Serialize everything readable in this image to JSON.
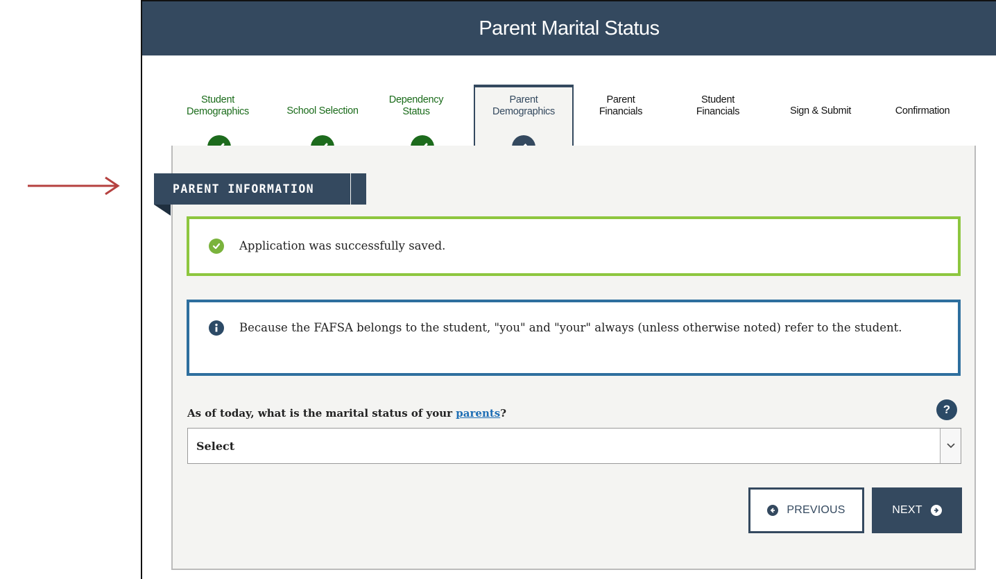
{
  "header": {
    "title": "Parent Marital Status"
  },
  "stepper": {
    "steps": [
      {
        "label": "Student Demographics",
        "state": "done"
      },
      {
        "label": "School Selection",
        "state": "done"
      },
      {
        "label": "Dependency Status",
        "state": "done"
      },
      {
        "label": "Parent Demographics",
        "state": "current"
      },
      {
        "label": "Parent Financials",
        "state": "todo"
      },
      {
        "label": "Student Financials",
        "state": "todo"
      },
      {
        "label": "Sign & Submit",
        "state": "todo"
      },
      {
        "label": "Confirmation",
        "state": "todo"
      }
    ]
  },
  "section": {
    "title": "PARENT INFORMATION"
  },
  "alerts": {
    "success": "Application was successfully saved.",
    "info": "Because the FAFSA belongs to the student, \"you\" and \"your\" always (unless otherwise noted) refer to the student."
  },
  "question": {
    "prefix": "As of today, what is the marital status of your ",
    "link": "parents",
    "suffix": "?",
    "help_label": "?"
  },
  "marital_select": {
    "value": "Select"
  },
  "buttons": {
    "previous": "PREVIOUS",
    "next": "NEXT"
  },
  "colors": {
    "header": "#34495f",
    "done": "#1d6b1d",
    "success_border": "#8dc63f",
    "info_border": "#2e6f9e",
    "pointer_arrow": "#b5413f"
  },
  "icons": {
    "pointer": "arrow-right-icon",
    "done": "checkmark-icon",
    "current": "pencil-icon",
    "success": "check-circle-icon",
    "info": "info-circle-icon",
    "help": "question-circle-icon",
    "select": "chevron-down-icon",
    "previous": "arrow-left-circle-icon",
    "next": "arrow-right-circle-icon"
  }
}
